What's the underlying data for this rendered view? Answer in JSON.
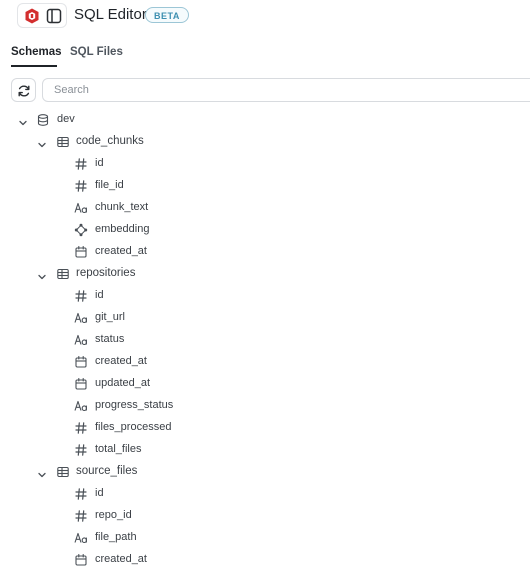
{
  "header": {
    "title": "SQL Editor",
    "badge": "BETA",
    "brand_color": "#d32f2f"
  },
  "tabs": [
    {
      "label": "Schemas",
      "active": true
    },
    {
      "label": "SQL Files",
      "active": false
    }
  ],
  "search": {
    "placeholder": "Search",
    "value": ""
  },
  "tree": {
    "database": {
      "name": "dev",
      "icon": "database-icon",
      "expanded": true
    },
    "tables": [
      {
        "name": "code_chunks",
        "expanded": true,
        "columns": [
          {
            "name": "id",
            "icon": "hash-icon"
          },
          {
            "name": "file_id",
            "icon": "hash-icon"
          },
          {
            "name": "chunk_text",
            "icon": "text-type-icon"
          },
          {
            "name": "embedding",
            "icon": "vector-icon"
          },
          {
            "name": "created_at",
            "icon": "calendar-icon"
          }
        ]
      },
      {
        "name": "repositories",
        "expanded": true,
        "columns": [
          {
            "name": "id",
            "icon": "hash-icon"
          },
          {
            "name": "git_url",
            "icon": "text-type-icon"
          },
          {
            "name": "status",
            "icon": "text-type-icon"
          },
          {
            "name": "created_at",
            "icon": "calendar-icon"
          },
          {
            "name": "updated_at",
            "icon": "calendar-icon"
          },
          {
            "name": "progress_status",
            "icon": "text-type-icon"
          },
          {
            "name": "files_processed",
            "icon": "hash-icon"
          },
          {
            "name": "total_files",
            "icon": "hash-icon"
          }
        ]
      },
      {
        "name": "source_files",
        "expanded": true,
        "columns": [
          {
            "name": "id",
            "icon": "hash-icon"
          },
          {
            "name": "repo_id",
            "icon": "hash-icon"
          },
          {
            "name": "file_path",
            "icon": "text-type-icon"
          },
          {
            "name": "created_at",
            "icon": "calendar-icon"
          }
        ]
      }
    ]
  }
}
